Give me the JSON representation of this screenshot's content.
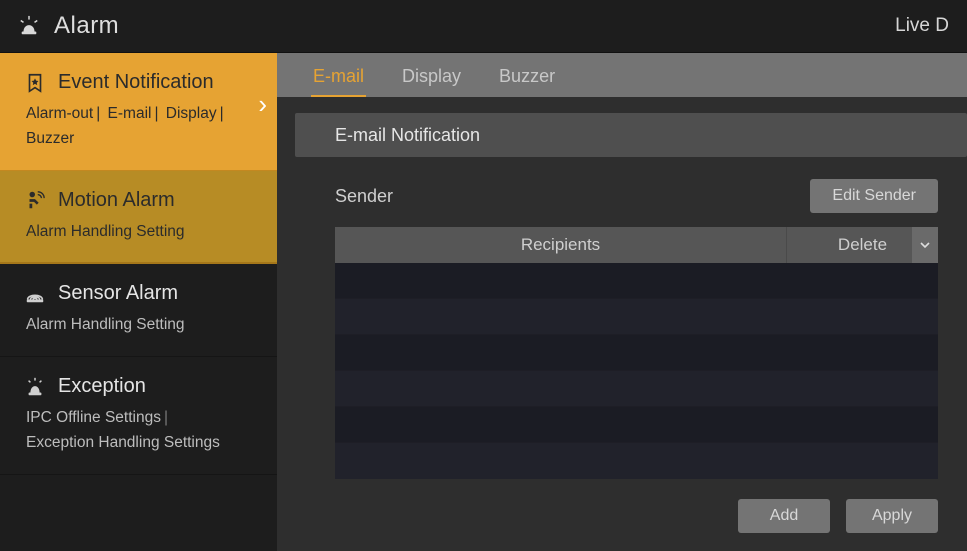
{
  "header": {
    "title": "Alarm",
    "right_label": "Live D"
  },
  "sidebar": {
    "items": [
      {
        "title": "Event Notification",
        "sub": [
          "Alarm-out",
          "E-mail",
          "Display",
          "Buzzer"
        ],
        "icon": "bookmark-icon",
        "active": true,
        "has_chevron": true
      },
      {
        "title": "Motion Alarm",
        "sub": [
          "Alarm Handling Setting"
        ],
        "icon": "motion-icon",
        "variant": "motion"
      },
      {
        "title": "Sensor Alarm",
        "sub": [
          "Alarm Handling Setting"
        ],
        "icon": "sensor-icon"
      },
      {
        "title": "Exception",
        "sub": [
          "IPC Offline Settings",
          "Exception Handling Settings"
        ],
        "icon": "siren-icon"
      }
    ]
  },
  "tabs": {
    "items": [
      {
        "label": "E-mail",
        "active": true
      },
      {
        "label": "Display",
        "active": false
      },
      {
        "label": "Buzzer",
        "active": false
      }
    ]
  },
  "section": {
    "title": "E-mail Notification"
  },
  "sender": {
    "label": "Sender",
    "edit_button": "Edit Sender"
  },
  "table": {
    "columns": {
      "recipients": "Recipients",
      "delete": "Delete"
    },
    "rows": [
      "",
      "",
      "",
      "",
      "",
      ""
    ]
  },
  "buttons": {
    "add": "Add",
    "apply": "Apply"
  },
  "colors": {
    "accent": "#e6a333",
    "motion": "#b78c25",
    "panel": "#2e2e2e"
  }
}
